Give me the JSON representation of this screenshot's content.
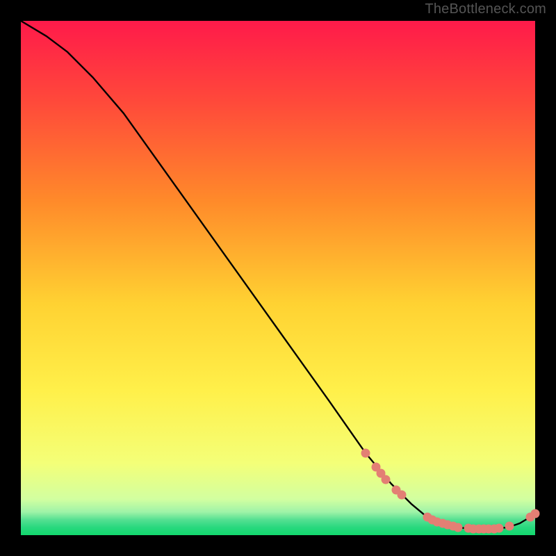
{
  "watermark": "TheBottleneck.com",
  "colors": {
    "marker": "#e37f74",
    "curve": "#000000",
    "gradient_top": "#ff1a4a",
    "gradient_mid1": "#ff9a2a",
    "gradient_mid2": "#ffe92a",
    "gradient_low": "#e8ff8e",
    "gradient_band": "#6de89e",
    "gradient_bottom": "#12d86d"
  },
  "chart_data": {
    "type": "line",
    "title": "",
    "xlabel": "",
    "ylabel": "",
    "xlim": [
      0,
      100
    ],
    "ylim": [
      0,
      100
    ],
    "series": [
      {
        "name": "curve",
        "x": [
          0,
          5,
          9,
          14,
          20,
          30,
          40,
          50,
          60,
          67,
          72,
          76,
          79,
          81,
          83,
          85,
          87,
          89,
          91,
          93,
          95,
          97,
          99,
          100
        ],
        "y": [
          100,
          97,
          94,
          89,
          82,
          68,
          54,
          40,
          26,
          16,
          10,
          6,
          3.5,
          2.5,
          2,
          1.5,
          1.3,
          1.2,
          1.2,
          1.3,
          1.6,
          2.3,
          3.5,
          4.2
        ]
      }
    ],
    "markers": [
      {
        "x": 67,
        "y": 16
      },
      {
        "x": 69,
        "y": 13.2
      },
      {
        "x": 70,
        "y": 12
      },
      {
        "x": 71,
        "y": 10.8
      },
      {
        "x": 73,
        "y": 8.8
      },
      {
        "x": 74,
        "y": 7.8
      },
      {
        "x": 79,
        "y": 3.5
      },
      {
        "x": 80,
        "y": 3.0
      },
      {
        "x": 81,
        "y": 2.6
      },
      {
        "x": 82,
        "y": 2.3
      },
      {
        "x": 83,
        "y": 2.0
      },
      {
        "x": 84,
        "y": 1.7
      },
      {
        "x": 85,
        "y": 1.5
      },
      {
        "x": 87,
        "y": 1.3
      },
      {
        "x": 88,
        "y": 1.2
      },
      {
        "x": 89,
        "y": 1.2
      },
      {
        "x": 90,
        "y": 1.2
      },
      {
        "x": 91,
        "y": 1.2
      },
      {
        "x": 92,
        "y": 1.2
      },
      {
        "x": 93,
        "y": 1.3
      },
      {
        "x": 95,
        "y": 1.7
      },
      {
        "x": 99,
        "y": 3.5
      },
      {
        "x": 100,
        "y": 4.2
      }
    ]
  }
}
